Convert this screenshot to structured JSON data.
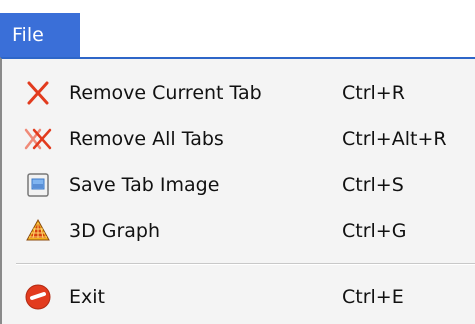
{
  "menubar": {
    "file_label": "File"
  },
  "menu": {
    "items": [
      {
        "label": "Remove Current Tab",
        "shortcut": "Ctrl+R",
        "icon": "remove-x-icon"
      },
      {
        "label": "Remove All Tabs",
        "shortcut": "Ctrl+Alt+R",
        "icon": "remove-all-x-icon"
      },
      {
        "label": "Save Tab Image",
        "shortcut": "Ctrl+S",
        "icon": "save-image-icon"
      },
      {
        "label": "3D Graph",
        "shortcut": "Ctrl+G",
        "icon": "3d-graph-icon"
      },
      {
        "label": "Exit",
        "shortcut": "Ctrl+E",
        "icon": "exit-icon"
      }
    ]
  },
  "colors": {
    "menu_header_bg": "#3a6fd8",
    "menu_bg": "#f4f4f4",
    "accent_red": "#e23b1e"
  }
}
